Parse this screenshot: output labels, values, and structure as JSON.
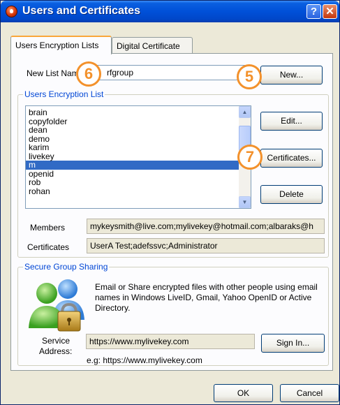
{
  "window": {
    "title": "Users and Certificates",
    "help_label": "?",
    "close_label": "✕"
  },
  "tabs": [
    {
      "label": "Users Encryption Lists",
      "active": true
    },
    {
      "label": "Digital Certificate",
      "active": false
    }
  ],
  "list_name": {
    "label": "New List Name",
    "value": "rfgroup"
  },
  "buttons": {
    "new": "New...",
    "edit": "Edit...",
    "certificates": "Certificates...",
    "delete": "Delete",
    "sign_in": "Sign In...",
    "ok": "OK",
    "cancel": "Cancel"
  },
  "users_group": {
    "legend": "Users Encryption List",
    "items": [
      "brain",
      "copyfolder",
      "dean",
      "demo",
      "karim",
      "livekey",
      "m",
      "openid",
      "rob",
      "rohan"
    ],
    "selected": "m",
    "scroll_up": "▲",
    "scroll_down": "▼"
  },
  "members": {
    "label": "Members",
    "value": "mykeysmith@live.com;mylivekey@hotmail.com;albaraks@h"
  },
  "certificates": {
    "label": "Certificates",
    "value": "UserA Test;adefssvc;Administrator"
  },
  "sharing_group": {
    "legend": "Secure Group Sharing",
    "description": "Email or Share encrypted files with other people using email names in Windows LiveID, Gmail, Yahoo OpenID or Active Directory.",
    "service_label_1": "Service",
    "service_label_2": "Address:",
    "service_value": "https://www.mylivekey.com",
    "example": "e.g: https://www.mylivekey.com"
  },
  "markers": {
    "m5": "5",
    "m6": "6",
    "m7": "7"
  },
  "colors": {
    "titlebar": "#0050d8",
    "accent_orange": "#f3912b",
    "selection": "#316ac5",
    "group_legend": "#0046d5"
  },
  "icons": {
    "app": "app-icon",
    "users": "users-lock-icon"
  }
}
